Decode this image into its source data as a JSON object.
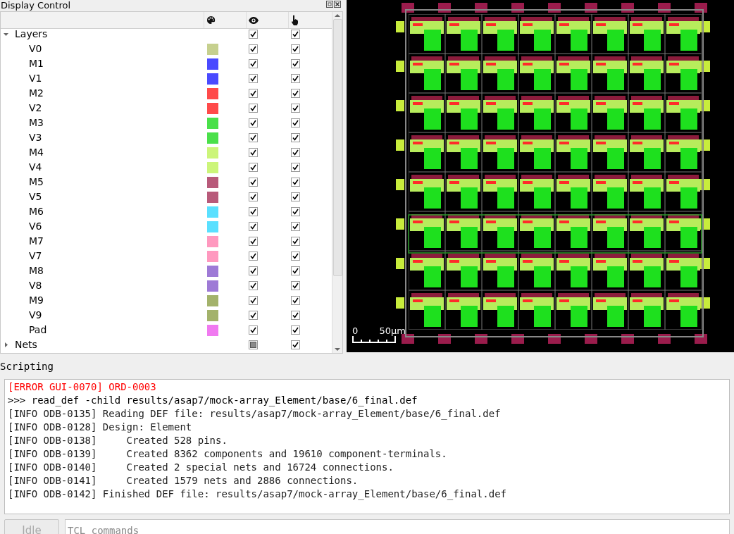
{
  "display_control": {
    "title": "Display Control",
    "tree": [
      {
        "label": "Layers",
        "expanded": true,
        "visible": true,
        "selectable": true,
        "children": [
          {
            "label": "V0",
            "color": "#c6d08e",
            "visible": true,
            "selectable": true
          },
          {
            "label": "M1",
            "color": "#4a4aff",
            "visible": true,
            "selectable": true
          },
          {
            "label": "V1",
            "color": "#4a4aff",
            "visible": true,
            "selectable": true
          },
          {
            "label": "M2",
            "color": "#ff4a4a",
            "visible": true,
            "selectable": true
          },
          {
            "label": "V2",
            "color": "#ff4a4a",
            "visible": true,
            "selectable": true
          },
          {
            "label": "M3",
            "color": "#4ae04a",
            "visible": true,
            "selectable": true
          },
          {
            "label": "V3",
            "color": "#4ae04a",
            "visible": true,
            "selectable": true
          },
          {
            "label": "M4",
            "color": "#ccf57a",
            "visible": true,
            "selectable": true
          },
          {
            "label": "V4",
            "color": "#ccf57a",
            "visible": true,
            "selectable": true
          },
          {
            "label": "M5",
            "color": "#b85a7a",
            "visible": true,
            "selectable": true
          },
          {
            "label": "V5",
            "color": "#b85a7a",
            "visible": true,
            "selectable": true
          },
          {
            "label": "M6",
            "color": "#5ae0ff",
            "visible": true,
            "selectable": true
          },
          {
            "label": "V6",
            "color": "#5ae0ff",
            "visible": true,
            "selectable": true
          },
          {
            "label": "M7",
            "color": "#ff99bf",
            "visible": true,
            "selectable": true
          },
          {
            "label": "V7",
            "color": "#ff99bf",
            "visible": true,
            "selectable": true
          },
          {
            "label": "M8",
            "color": "#9e7ad6",
            "visible": true,
            "selectable": true
          },
          {
            "label": "V8",
            "color": "#9e7ad6",
            "visible": true,
            "selectable": true
          },
          {
            "label": "M9",
            "color": "#a3b26b",
            "visible": true,
            "selectable": true
          },
          {
            "label": "V9",
            "color": "#a3b26b",
            "visible": true,
            "selectable": true
          },
          {
            "label": "Pad",
            "color": "#f07af0",
            "visible": true,
            "selectable": true
          }
        ]
      },
      {
        "label": "Nets",
        "expanded": false,
        "partial": true,
        "selectable": true
      }
    ]
  },
  "layout_view": {
    "scale_bar": {
      "start": "0",
      "end": "50µm"
    }
  },
  "scripting": {
    "title": "Scripting",
    "lines": [
      {
        "kind": "error",
        "text": "[ERROR GUI-0070] ORD-0003"
      },
      {
        "kind": "command",
        "text": ">>> read_def -child results/asap7/mock-array_Element/base/6_final.def"
      },
      {
        "kind": "info",
        "text": "[INFO ODB-0135] Reading DEF file: results/asap7/mock-array_Element/base/6_final.def"
      },
      {
        "kind": "info",
        "text": "[INFO ODB-0128] Design: Element"
      },
      {
        "kind": "info",
        "text": "[INFO ODB-0138]     Created 528 pins."
      },
      {
        "kind": "info",
        "text": "[INFO ODB-0139]     Created 8362 components and 19610 component-terminals."
      },
      {
        "kind": "info",
        "text": "[INFO ODB-0140]     Created 2 special nets and 16724 connections."
      },
      {
        "kind": "info",
        "text": "[INFO ODB-0141]     Created 1579 nets and 2886 connections."
      },
      {
        "kind": "info",
        "text": "[INFO ODB-0142] Finished DEF file: results/asap7/mock-array_Element/base/6_final.def"
      }
    ],
    "status_button": {
      "label": "Idle",
      "disabled": true
    },
    "command_field": {
      "placeholder": "TCL commands"
    }
  }
}
